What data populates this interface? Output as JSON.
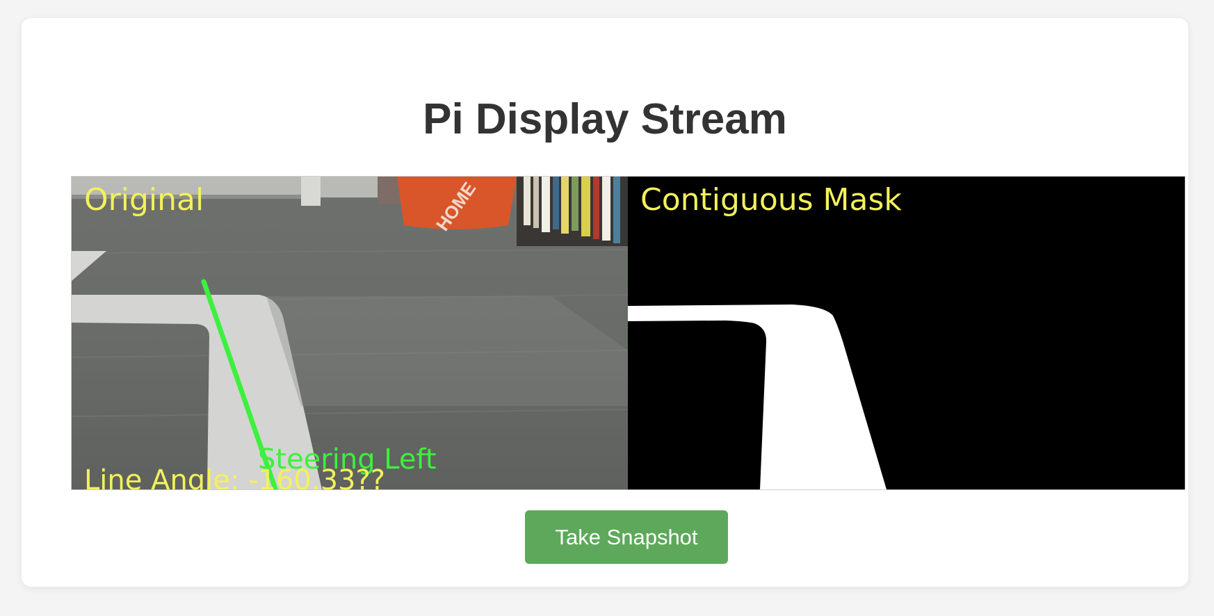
{
  "page": {
    "title": "Pi Display Stream"
  },
  "stream": {
    "left_panel_label": "Original",
    "right_panel_label": "Contiguous Mask",
    "steering_text": "Steering Left",
    "angle_text": "Line Angle: -160.33??",
    "overlay_label_color": "#f2f25a",
    "steering_line_color": "#3df03d"
  },
  "actions": {
    "snapshot_label": "Take Snapshot"
  },
  "colors": {
    "button": "#5ea85b",
    "title": "#333333"
  }
}
